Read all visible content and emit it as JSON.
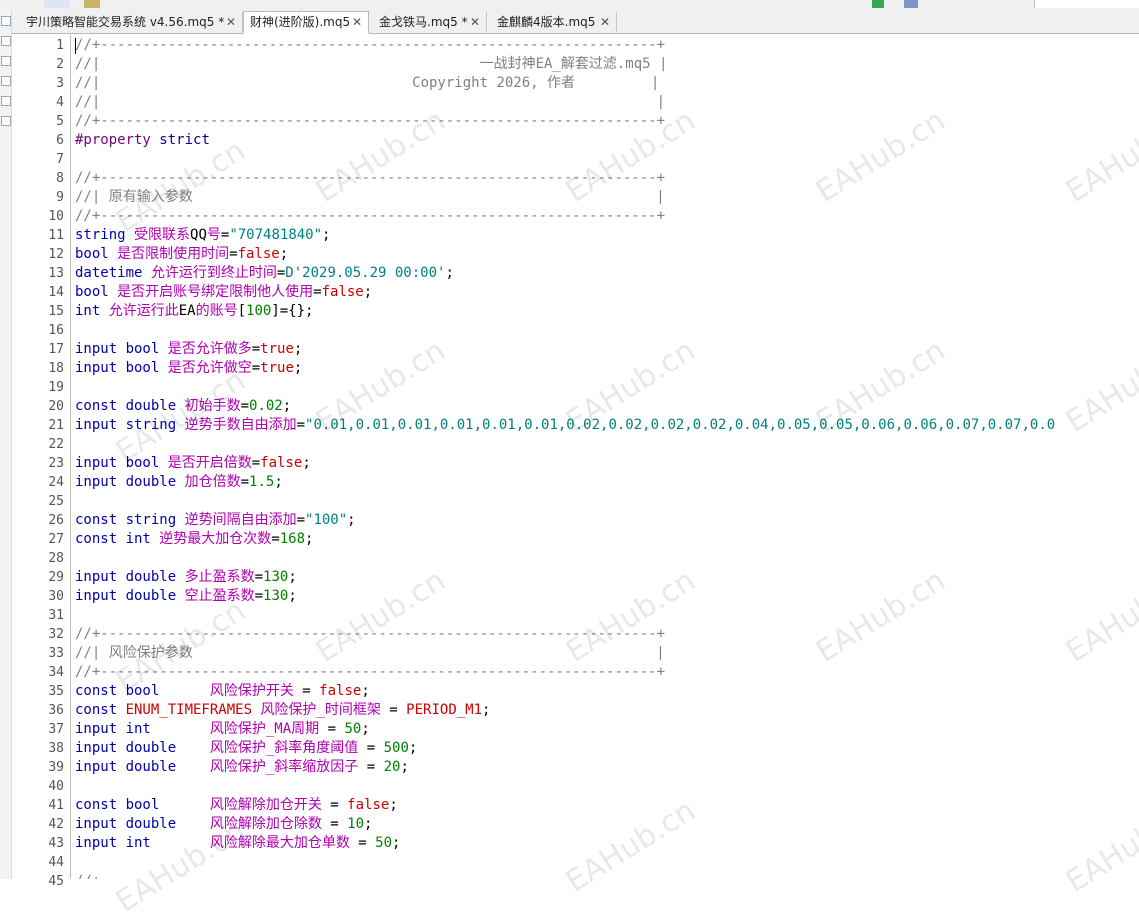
{
  "tabs": [
    {
      "label": "宇川策略智能交易系统 v4.56.mq5 *",
      "active": false,
      "closable": true
    },
    {
      "label": "财神(进阶版).mq5",
      "active": true,
      "closable": true
    },
    {
      "label": "金戈铁马.mq5 *",
      "active": false,
      "closable": true
    },
    {
      "label": "金麒麟4版本.mq5",
      "active": false,
      "closable": true
    }
  ],
  "close_glyph": "✕",
  "watermark": "EAHub.cn",
  "colors": {
    "keyword": "#0000aa",
    "identifier": "#b000b0",
    "number": "#008000",
    "string": "#008080",
    "literal": "#cc0000",
    "comment": "#808080"
  },
  "lines": [
    {
      "n": "1",
      "t": [
        [
          "cmt",
          "//+------------------------------------------------------------------+"
        ]
      ]
    },
    {
      "n": "2",
      "t": [
        [
          "cmt",
          "//|                                             一战封神EA_解套过滤.mq5 |"
        ]
      ]
    },
    {
      "n": "3",
      "t": [
        [
          "cmt",
          "//|                                     Copyright 2026, 作者         |"
        ]
      ]
    },
    {
      "n": "4",
      "t": [
        [
          "cmt",
          "//|                                                                  |"
        ]
      ]
    },
    {
      "n": "5",
      "t": [
        [
          "cmt",
          "//+------------------------------------------------------------------+"
        ]
      ]
    },
    {
      "n": "6",
      "t": [
        [
          "pp",
          "#property "
        ],
        [
          "kw",
          "strict"
        ]
      ]
    },
    {
      "n": "7",
      "t": []
    },
    {
      "n": "8",
      "t": [
        [
          "cmt",
          "//+------------------------------------------------------------------+"
        ]
      ]
    },
    {
      "n": "9",
      "t": [
        [
          "cmt",
          "//| 原有输入参数                                                       |"
        ]
      ]
    },
    {
      "n": "10",
      "t": [
        [
          "cmt",
          "//+------------------------------------------------------------------+"
        ]
      ]
    },
    {
      "n": "11",
      "t": [
        [
          "kw",
          "string "
        ],
        [
          "id",
          "受限联系"
        ],
        [
          "op",
          "QQ"
        ],
        [
          "id",
          "号"
        ],
        [
          "op",
          "="
        ],
        [
          "str",
          "\"707481840\""
        ],
        [
          "op",
          ";"
        ]
      ]
    },
    {
      "n": "12",
      "t": [
        [
          "kw",
          "bool "
        ],
        [
          "id",
          "是否限制使用时间"
        ],
        [
          "op",
          "="
        ],
        [
          "lit",
          "false"
        ],
        [
          "op",
          ";"
        ]
      ]
    },
    {
      "n": "13",
      "t": [
        [
          "kw",
          "datetime "
        ],
        [
          "id",
          "允许运行到终止时间"
        ],
        [
          "op",
          "="
        ],
        [
          "str",
          "D'2029.05.29 00:00'"
        ],
        [
          "op",
          ";"
        ]
      ]
    },
    {
      "n": "14",
      "t": [
        [
          "kw",
          "bool "
        ],
        [
          "id",
          "是否开启账号绑定限制他人使用"
        ],
        [
          "op",
          "="
        ],
        [
          "lit",
          "false"
        ],
        [
          "op",
          ";"
        ]
      ]
    },
    {
      "n": "15",
      "t": [
        [
          "kw",
          "int "
        ],
        [
          "id",
          "允许运行此"
        ],
        [
          "op",
          "EA"
        ],
        [
          "id",
          "的账号"
        ],
        [
          "op",
          "["
        ],
        [
          "num",
          "100"
        ],
        [
          "op",
          "]={};"
        ]
      ]
    },
    {
      "n": "16",
      "t": []
    },
    {
      "n": "17",
      "t": [
        [
          "kw",
          "input bool "
        ],
        [
          "id",
          "是否允许做多"
        ],
        [
          "op",
          "="
        ],
        [
          "lit",
          "true"
        ],
        [
          "op",
          ";"
        ]
      ]
    },
    {
      "n": "18",
      "t": [
        [
          "kw",
          "input bool "
        ],
        [
          "id",
          "是否允许做空"
        ],
        [
          "op",
          "="
        ],
        [
          "lit",
          "true"
        ],
        [
          "op",
          ";"
        ]
      ]
    },
    {
      "n": "19",
      "t": []
    },
    {
      "n": "20",
      "t": [
        [
          "kw",
          "const double "
        ],
        [
          "id",
          "初始手数"
        ],
        [
          "op",
          "="
        ],
        [
          "num",
          "0.02"
        ],
        [
          "op",
          ";"
        ]
      ]
    },
    {
      "n": "21",
      "t": [
        [
          "kw",
          "input string "
        ],
        [
          "id",
          "逆势手数自由添加"
        ],
        [
          "op",
          "="
        ],
        [
          "str",
          "\"0.01,0.01,0.01,0.01,0.01,0.01,0.02,0.02,0.02,0.02,0.04,0.05,0.05,0.06,0.06,0.07,0.07,0.0"
        ]
      ]
    },
    {
      "n": "22",
      "t": []
    },
    {
      "n": "23",
      "t": [
        [
          "kw",
          "input bool "
        ],
        [
          "id",
          "是否开启倍数"
        ],
        [
          "op",
          "="
        ],
        [
          "lit",
          "false"
        ],
        [
          "op",
          ";"
        ]
      ]
    },
    {
      "n": "24",
      "t": [
        [
          "kw",
          "input double "
        ],
        [
          "id",
          "加仓倍数"
        ],
        [
          "op",
          "="
        ],
        [
          "num",
          "1.5"
        ],
        [
          "op",
          ";"
        ]
      ]
    },
    {
      "n": "25",
      "t": []
    },
    {
      "n": "26",
      "t": [
        [
          "kw",
          "const string "
        ],
        [
          "id",
          "逆势间隔自由添加"
        ],
        [
          "op",
          "="
        ],
        [
          "str",
          "\"100\""
        ],
        [
          "op",
          ";"
        ]
      ]
    },
    {
      "n": "27",
      "t": [
        [
          "kw",
          "const int "
        ],
        [
          "id",
          "逆势最大加仓次数"
        ],
        [
          "op",
          "="
        ],
        [
          "num",
          "168"
        ],
        [
          "op",
          ";"
        ]
      ]
    },
    {
      "n": "28",
      "t": []
    },
    {
      "n": "29",
      "t": [
        [
          "kw",
          "input double "
        ],
        [
          "id",
          "多止盈系数"
        ],
        [
          "op",
          "="
        ],
        [
          "num",
          "130"
        ],
        [
          "op",
          ";"
        ]
      ]
    },
    {
      "n": "30",
      "t": [
        [
          "kw",
          "input double "
        ],
        [
          "id",
          "空止盈系数"
        ],
        [
          "op",
          "="
        ],
        [
          "num",
          "130"
        ],
        [
          "op",
          ";"
        ]
      ]
    },
    {
      "n": "31",
      "t": []
    },
    {
      "n": "32",
      "t": [
        [
          "cmt",
          "//+------------------------------------------------------------------+"
        ]
      ]
    },
    {
      "n": "33",
      "t": [
        [
          "cmt",
          "//| 风险保护参数                                                       |"
        ]
      ]
    },
    {
      "n": "34",
      "t": [
        [
          "cmt",
          "//+------------------------------------------------------------------+"
        ]
      ]
    },
    {
      "n": "35",
      "t": [
        [
          "kw",
          "const bool      "
        ],
        [
          "id",
          "风险保护开关"
        ],
        [
          "op",
          " = "
        ],
        [
          "lit",
          "false"
        ],
        [
          "op",
          ";"
        ]
      ]
    },
    {
      "n": "36",
      "t": [
        [
          "kw",
          "const "
        ],
        [
          "lit",
          "ENUM_TIMEFRAMES "
        ],
        [
          "id",
          "风险保护_时间框架"
        ],
        [
          "op",
          " = "
        ],
        [
          "lit",
          "PERIOD_M1"
        ],
        [
          "op",
          ";"
        ]
      ]
    },
    {
      "n": "37",
      "t": [
        [
          "kw",
          "input int       "
        ],
        [
          "id",
          "风险保护_MA周期"
        ],
        [
          "op",
          " = "
        ],
        [
          "num",
          "50"
        ],
        [
          "op",
          ";"
        ]
      ]
    },
    {
      "n": "38",
      "t": [
        [
          "kw",
          "input double    "
        ],
        [
          "id",
          "风险保护_斜率角度阈值"
        ],
        [
          "op",
          " = "
        ],
        [
          "num",
          "500"
        ],
        [
          "op",
          ";"
        ]
      ]
    },
    {
      "n": "39",
      "t": [
        [
          "kw",
          "input double    "
        ],
        [
          "id",
          "风险保护_斜率缩放因子"
        ],
        [
          "op",
          " = "
        ],
        [
          "num",
          "20"
        ],
        [
          "op",
          ";"
        ]
      ]
    },
    {
      "n": "40",
      "t": []
    },
    {
      "n": "41",
      "t": [
        [
          "kw",
          "const bool      "
        ],
        [
          "id",
          "风险解除加仓开关"
        ],
        [
          "op",
          " = "
        ],
        [
          "lit",
          "false"
        ],
        [
          "op",
          ";"
        ]
      ]
    },
    {
      "n": "42",
      "t": [
        [
          "kw",
          "input double    "
        ],
        [
          "id",
          "风险解除加仓除数"
        ],
        [
          "op",
          " = "
        ],
        [
          "num",
          "10"
        ],
        [
          "op",
          ";"
        ]
      ]
    },
    {
      "n": "43",
      "t": [
        [
          "kw",
          "input int       "
        ],
        [
          "id",
          "风险解除最大加仓单数"
        ],
        [
          "op",
          " = "
        ],
        [
          "num",
          "50"
        ],
        [
          "op",
          ";"
        ]
      ]
    },
    {
      "n": "44",
      "t": []
    },
    {
      "n": "45",
      "t": [
        [
          "cmt",
          "//+"
        ]
      ]
    }
  ]
}
